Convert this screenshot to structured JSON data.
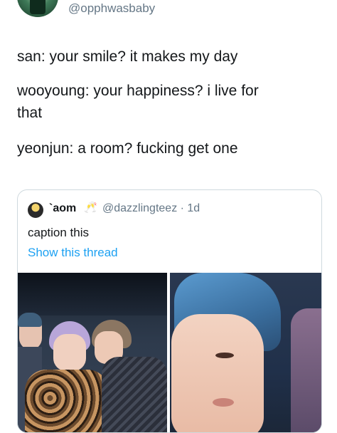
{
  "tweet": {
    "handle": "@opphwasbaby",
    "lines": [
      "san: your smile? it makes my day",
      "wooyoung: your happiness? i live for",
      "that",
      "yeonjun: a room? fucking get one"
    ]
  },
  "quote": {
    "name": "`aom",
    "emoji": "🥂",
    "meta": "@dazzlingteez · 1d",
    "caption": "caption this",
    "thread_link": "Show this thread"
  },
  "colors": {
    "text": "#14171a",
    "secondary": "#657786",
    "link": "#1da1f2",
    "border": "#cfd9de"
  }
}
